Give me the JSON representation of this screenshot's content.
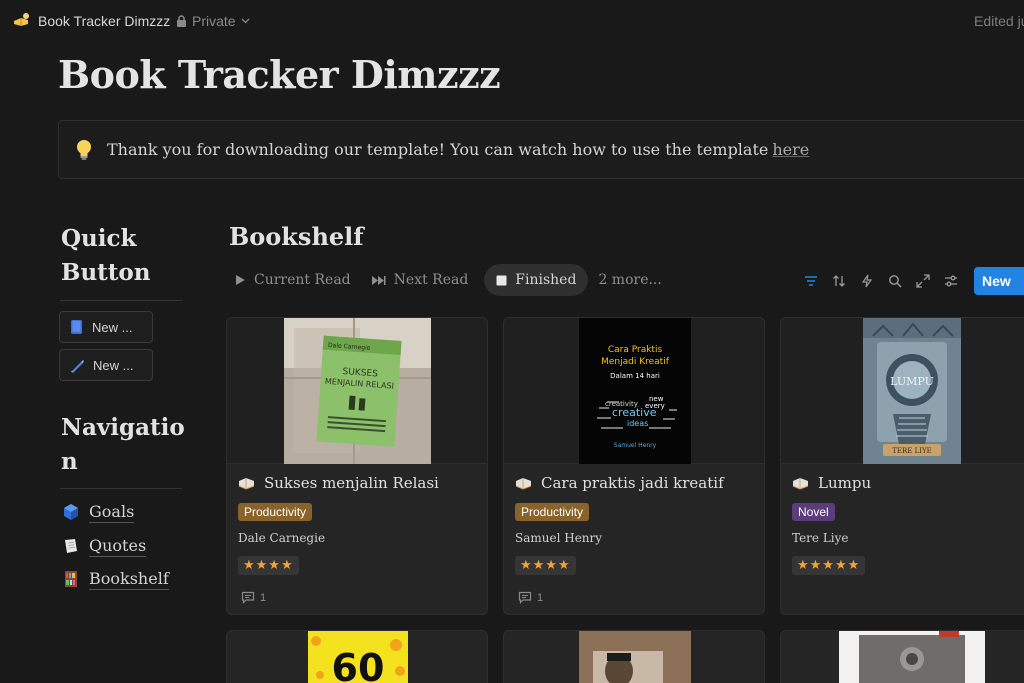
{
  "topbar": {
    "page_icon": "reading-book-icon",
    "title": "Book Tracker Dimzzz",
    "privacy": "Private",
    "edited": "Edited ju"
  },
  "page": {
    "title": "Book Tracker Dimzzz"
  },
  "callout": {
    "icon": "lightbulb-icon",
    "text": "Thank you for downloading our template! You can watch how to use the template",
    "link": "here"
  },
  "sidebar": {
    "quick_heading_line1": "Quick",
    "quick_heading_line2": "Button",
    "quick_buttons": [
      {
        "label": "New ...",
        "icon": "book-icon"
      },
      {
        "label": "New ...",
        "icon": "pen-icon"
      }
    ],
    "nav_heading_line1": "Navigatio",
    "nav_heading_line2": "n",
    "nav_items": [
      {
        "label": "Goals",
        "icon": "cube-icon"
      },
      {
        "label": "Quotes",
        "icon": "note-icon"
      },
      {
        "label": "Bookshelf",
        "icon": "bookshelf-icon"
      }
    ]
  },
  "bookshelf": {
    "title": "Bookshelf",
    "tabs": [
      {
        "label": "Current Read",
        "icon": "play-icon"
      },
      {
        "label": "Next Read",
        "icon": "fast-forward-icon"
      },
      {
        "label": "Finished",
        "icon": "stop-icon"
      }
    ],
    "more_tabs": "2 more...",
    "new_button": "New",
    "colors": {
      "accent": "#2383e2",
      "productivity": "#89632a",
      "novel": "#5a3d7a",
      "stars": "#f0a33a"
    },
    "cards": [
      {
        "title": "Sukses menjalin Relasi",
        "tag": "Productivity",
        "author": "Dale Carnegie",
        "rating": 4,
        "stars": "★★★★",
        "comments": "1",
        "cover": {
          "brand": "Dale Carnegie",
          "title_line1": "SUKSES",
          "title_line2": "MENJALIN RELASI"
        }
      },
      {
        "title": "Cara praktis jadi kreatif",
        "tag": "Productivity",
        "author": "Samuel Henry",
        "rating": 4,
        "stars": "★★★★",
        "comments": "1",
        "cover": {
          "line1": "Cara Praktis",
          "line2": "Menjadi Kreatif",
          "line3": "Dalam 14 hari",
          "word1": "creativity",
          "word2": "new",
          "word3": "every",
          "word4": "creative",
          "word5": "ideas",
          "author": "Samuel Henry"
        }
      },
      {
        "title": "Lumpu",
        "tag": "Novel",
        "author": "Tere Liye",
        "rating": 5,
        "stars": "★★★★★",
        "comments": "",
        "cover": {
          "title": "LUMPU",
          "author": "TERE LIYE"
        }
      }
    ],
    "next_row_covers": [
      {
        "label": "60"
      },
      {
        "label": ""
      },
      {
        "label": ""
      }
    ]
  }
}
